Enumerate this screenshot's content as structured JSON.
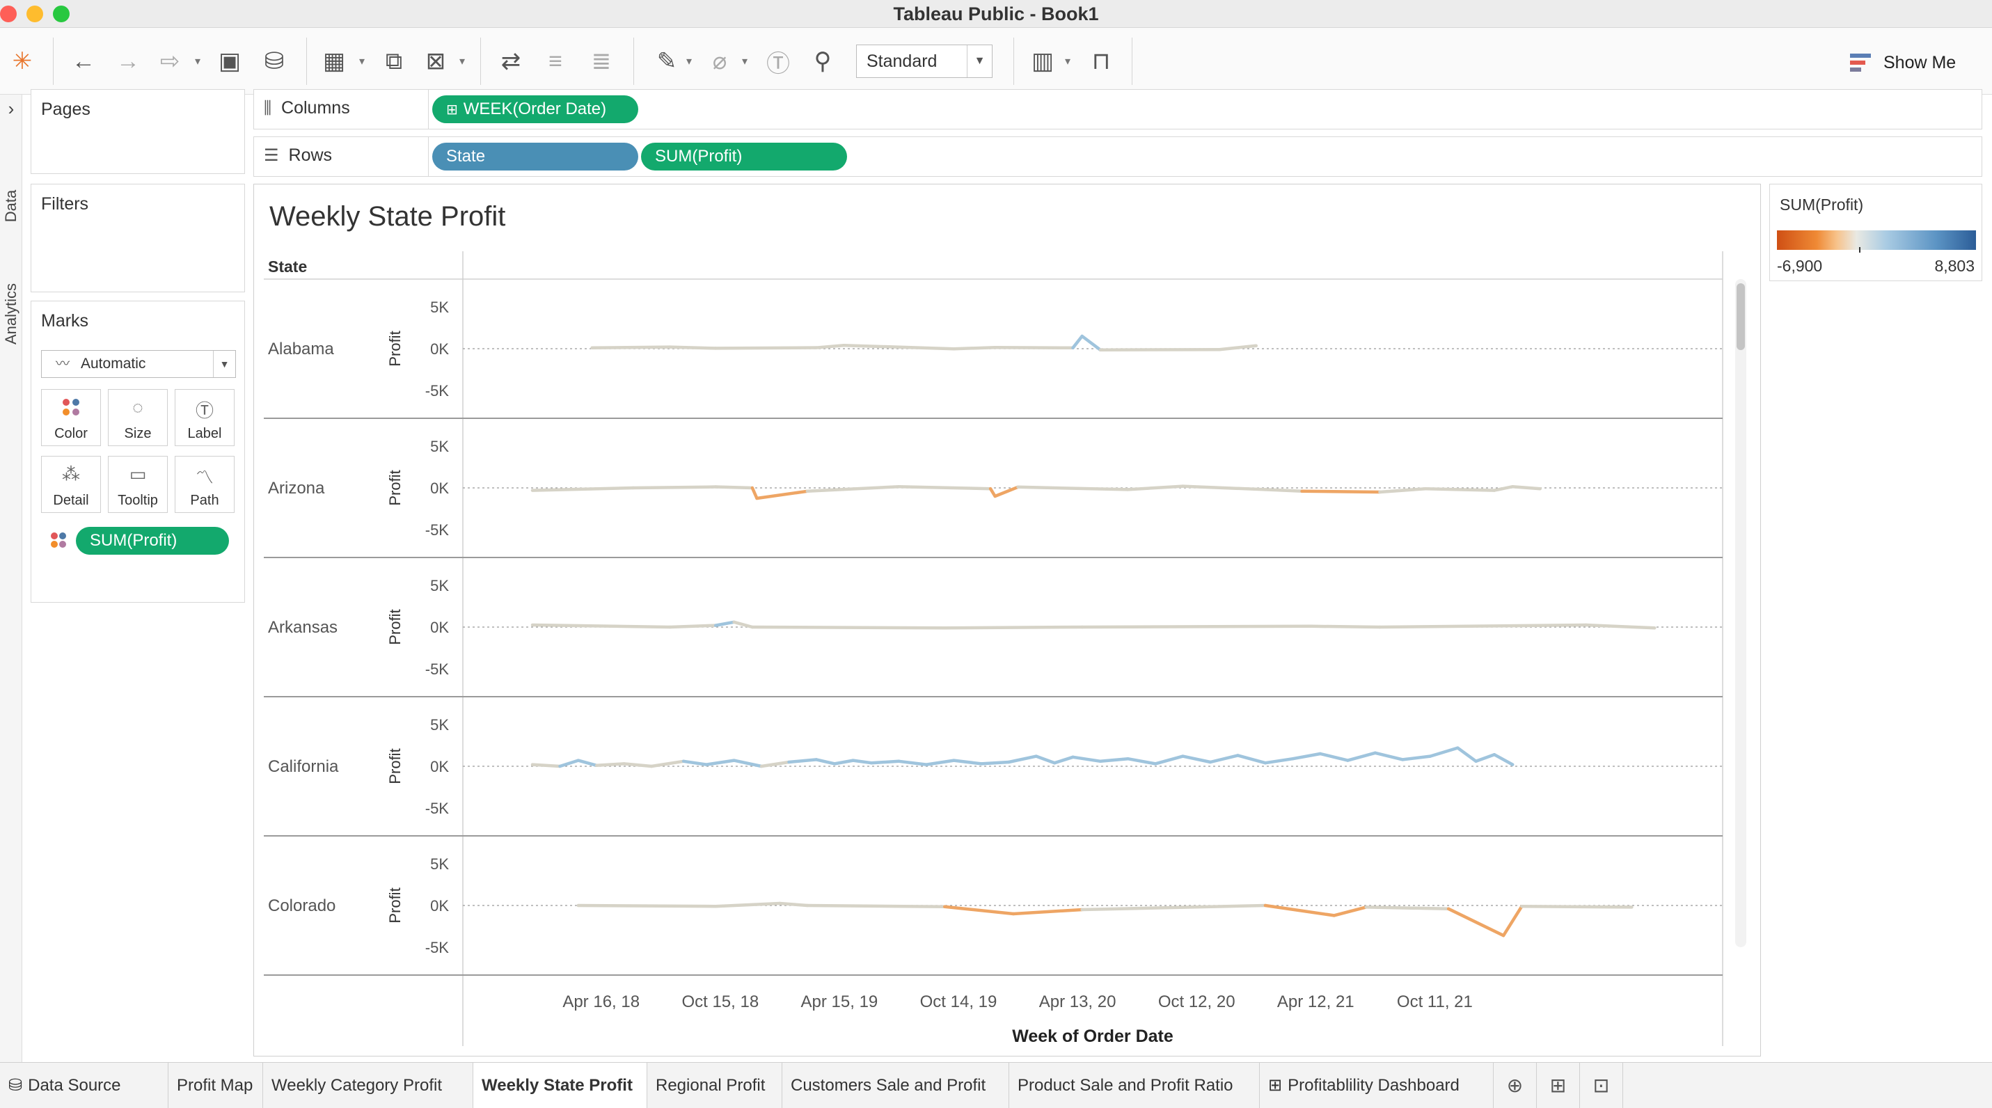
{
  "window": {
    "title": "Tableau Public - Book1"
  },
  "toolbar": {
    "view_mode": "Standard",
    "show_me": "Show Me"
  },
  "side_tabs": {
    "data": "Data",
    "analytics": "Analytics"
  },
  "cards": {
    "pages": "Pages",
    "filters": "Filters",
    "marks": {
      "title": "Marks",
      "type": "Automatic",
      "buttons": [
        "Color",
        "Size",
        "Label",
        "Detail",
        "Tooltip",
        "Path"
      ],
      "pill": "SUM(Profit)"
    }
  },
  "shelves": {
    "columns_label": "Columns",
    "columns_pill": "WEEK(Order Date)",
    "rows_label": "Rows",
    "rows_pills": [
      "State",
      "SUM(Profit)"
    ]
  },
  "legend": {
    "title": "SUM(Profit)",
    "min": "-6,900",
    "max": "8,803"
  },
  "colors": {
    "green_pill": "#13a96d",
    "blue_pill": "#4a8fb5",
    "positive_line": "#9fc4dd",
    "negative_line": "#eea564",
    "neutral_line": "#d6d3c7"
  },
  "tabs": [
    "Data Source",
    "Profit Map",
    "Weekly Category Profit",
    "Weekly State Profit",
    "Regional Profit",
    "Customers Sale and Profit",
    "Product Sale and Profit Ratio",
    "Profitablility Dashboard"
  ],
  "active_tab": "Weekly State Profit",
  "chart_data": {
    "type": "line",
    "title": "Weekly State Profit",
    "row_header": "State",
    "xlabel": "Week of Order Date",
    "ylabel": "Profit",
    "x_ticks": [
      "Apr 16, 18",
      "Oct 15, 18",
      "Apr 15, 19",
      "Oct 14, 19",
      "Apr 13, 20",
      "Oct 12, 20",
      "Apr 12, 21",
      "Oct 11, 21"
    ],
    "y_ticks": [
      "5K",
      "0K",
      "-5K"
    ],
    "ylim": [
      -6000,
      6000
    ],
    "x_unit": "weeks since Jan 1, 2018",
    "series": [
      {
        "name": "Alabama",
        "points": [
          [
            13,
            100
          ],
          [
            30,
            200
          ],
          [
            40,
            50
          ],
          [
            62,
            120
          ],
          [
            68,
            400
          ],
          [
            92,
            -20
          ],
          [
            101,
            150
          ],
          [
            118,
            100
          ],
          [
            120,
            1500
          ],
          [
            124,
            -150
          ],
          [
            150,
            -100
          ],
          [
            158,
            350
          ]
        ]
      },
      {
        "name": "Arizona",
        "points": [
          [
            0,
            -300
          ],
          [
            22,
            0
          ],
          [
            40,
            120
          ],
          [
            48,
            0
          ],
          [
            49,
            -1250
          ],
          [
            60,
            -400
          ],
          [
            80,
            150
          ],
          [
            100,
            -100
          ],
          [
            101,
            -1000
          ],
          [
            106,
            100
          ],
          [
            130,
            -200
          ],
          [
            142,
            200
          ],
          [
            160,
            -200
          ],
          [
            168,
            -400
          ],
          [
            185,
            -500
          ],
          [
            195,
            -100
          ],
          [
            210,
            -300
          ],
          [
            214,
            150
          ],
          [
            220,
            -100
          ]
        ]
      },
      {
        "name": "Arkansas",
        "points": [
          [
            0,
            250
          ],
          [
            30,
            0
          ],
          [
            40,
            200
          ],
          [
            44,
            600
          ],
          [
            48,
            0
          ],
          [
            90,
            -100
          ],
          [
            120,
            0
          ],
          [
            170,
            100
          ],
          [
            185,
            0
          ],
          [
            230,
            250
          ],
          [
            245,
            -100
          ]
        ]
      },
      {
        "name": "California",
        "points": [
          [
            0,
            200
          ],
          [
            6,
            0
          ],
          [
            10,
            700
          ],
          [
            14,
            100
          ],
          [
            20,
            300
          ],
          [
            26,
            0
          ],
          [
            33,
            600
          ],
          [
            38,
            200
          ],
          [
            44,
            700
          ],
          [
            50,
            0
          ],
          [
            56,
            500
          ],
          [
            62,
            800
          ],
          [
            66,
            300
          ],
          [
            70,
            700
          ],
          [
            74,
            400
          ],
          [
            80,
            600
          ],
          [
            86,
            200
          ],
          [
            92,
            700
          ],
          [
            98,
            300
          ],
          [
            104,
            500
          ],
          [
            110,
            1200
          ],
          [
            114,
            400
          ],
          [
            118,
            1100
          ],
          [
            124,
            600
          ],
          [
            130,
            900
          ],
          [
            136,
            300
          ],
          [
            142,
            1200
          ],
          [
            148,
            500
          ],
          [
            154,
            1300
          ],
          [
            160,
            400
          ],
          [
            166,
            900
          ],
          [
            172,
            1500
          ],
          [
            178,
            700
          ],
          [
            184,
            1600
          ],
          [
            190,
            800
          ],
          [
            196,
            1200
          ],
          [
            202,
            2200
          ],
          [
            206,
            600
          ],
          [
            210,
            1400
          ],
          [
            214,
            200
          ]
        ]
      },
      {
        "name": "Colorado",
        "points": [
          [
            10,
            0
          ],
          [
            40,
            -100
          ],
          [
            54,
            250
          ],
          [
            60,
            0
          ],
          [
            90,
            -150
          ],
          [
            105,
            -1000
          ],
          [
            120,
            -500
          ],
          [
            160,
            0
          ],
          [
            175,
            -1200
          ],
          [
            182,
            -200
          ],
          [
            200,
            -400
          ],
          [
            212,
            -3600
          ],
          [
            216,
            -100
          ],
          [
            240,
            -200
          ]
        ]
      }
    ]
  }
}
